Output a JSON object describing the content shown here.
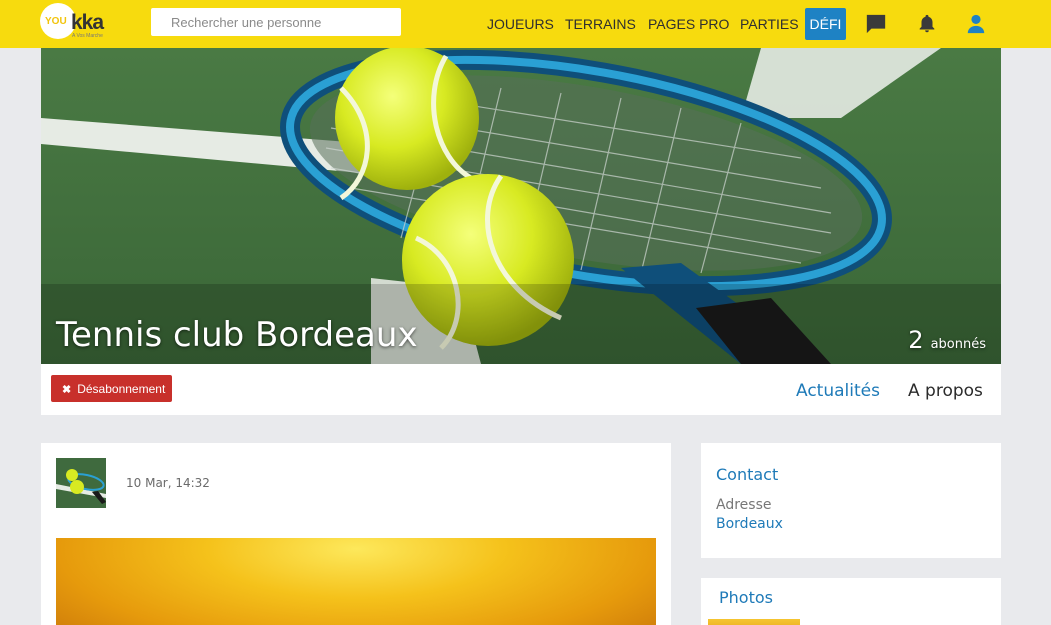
{
  "brand": {
    "logo_you": "YOU",
    "logo_kka": "kka",
    "logo_tagline": "A Vos Marche"
  },
  "search": {
    "placeholder": "Rechercher une personne"
  },
  "nav": {
    "joueurs": "JOUEURS",
    "terrains": "TERRAINS",
    "pages_pro": "PAGES PRO",
    "parties": "PARTIES",
    "defi": "DÉFI"
  },
  "icons": {
    "messages": "chat-icon",
    "notifications": "bell-icon",
    "profile": "user-icon",
    "unsubscribe": "close-icon"
  },
  "colors": {
    "topbar": "#f7db0e",
    "accent": "#1e82c4",
    "danger": "#c8302b",
    "link": "#1e7ab8"
  },
  "page": {
    "title": "Tennis club Bordeaux",
    "followers_count": "2",
    "followers_label": "abonnés"
  },
  "actions": {
    "unsubscribe_icon": "✖",
    "unsubscribe_label": "Désabonnement"
  },
  "tabs": {
    "news": "Actualités",
    "about": "A propos"
  },
  "post": {
    "timestamp": "10 Mar, 14:32"
  },
  "contact": {
    "title": "Contact",
    "address_label": "Adresse",
    "address_value": "Bordeaux"
  },
  "photos": {
    "title": "Photos"
  }
}
